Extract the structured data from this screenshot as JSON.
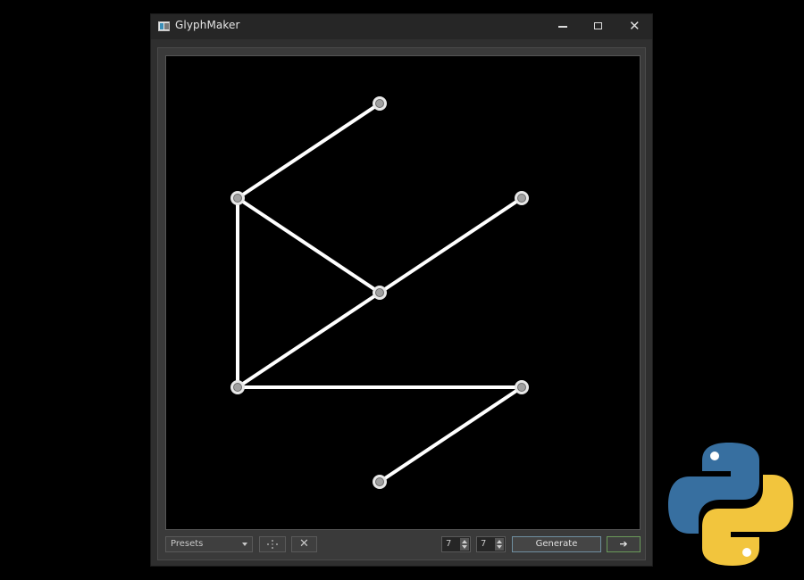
{
  "window": {
    "title": "GlyphMaker",
    "minimize_icon": "minimize-icon",
    "maximize_icon": "maximize-icon",
    "close_glyph": "✕"
  },
  "glyph": {
    "grid": 7,
    "node_color": "#a0a0a0",
    "line_color": "#ffffff",
    "nodes": [
      [
        5,
        1
      ],
      [
        2,
        3
      ],
      [
        8,
        3
      ],
      [
        5,
        5
      ],
      [
        2,
        7
      ],
      [
        8,
        7
      ],
      [
        5,
        9
      ]
    ],
    "edges": [
      [
        0,
        1
      ],
      [
        1,
        3
      ],
      [
        1,
        4
      ],
      [
        2,
        3
      ],
      [
        3,
        4
      ],
      [
        4,
        5
      ],
      [
        5,
        6
      ]
    ]
  },
  "toolbar": {
    "presets_label": "Presets",
    "scatter_icon": "scatter-icon",
    "clear_glyph": "✕",
    "cols_value": "7",
    "rows_value": "7",
    "generate_label": "Generate",
    "next_glyph": "➔"
  },
  "branding": {
    "logo": "python-logo",
    "blue": "#376fa0",
    "yellow": "#f7c93c"
  }
}
